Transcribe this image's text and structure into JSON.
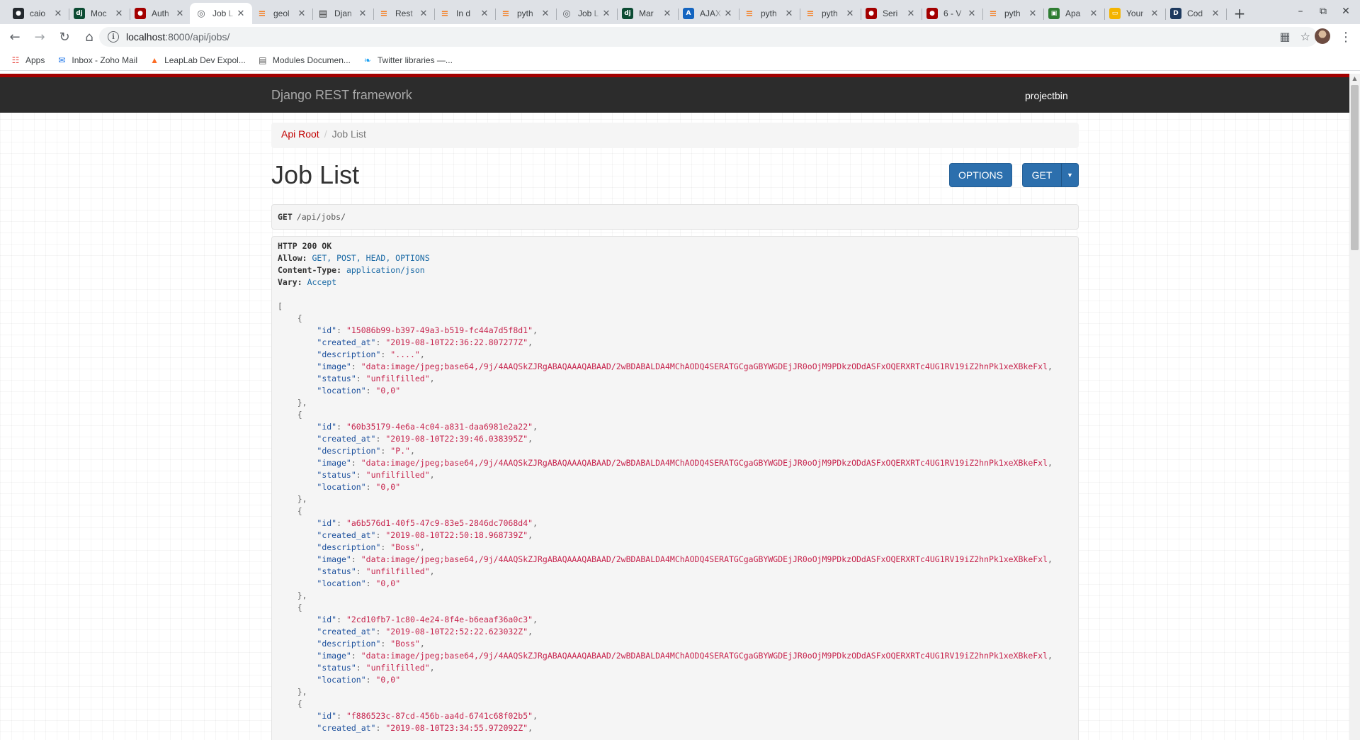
{
  "browser": {
    "tabs": [
      {
        "title": "caio",
        "icon": "github-icon",
        "color": "#24292e"
      },
      {
        "title": "Moc",
        "icon": "django-icon",
        "color": "#0c4b33"
      },
      {
        "title": "Auth",
        "icon": "django-rest-icon",
        "color": "#a30000"
      },
      {
        "title": "Job L",
        "icon": "globe-icon",
        "color": "#5f6368",
        "active": true
      },
      {
        "title": "geol",
        "icon": "stackoverflow-icon",
        "color": "#f48024"
      },
      {
        "title": "Djan",
        "icon": "book-icon",
        "color": "#333333"
      },
      {
        "title": "Rest",
        "icon": "stackoverflow-icon",
        "color": "#f48024"
      },
      {
        "title": "In d",
        "icon": "stackoverflow-icon",
        "color": "#f48024"
      },
      {
        "title": "pyth",
        "icon": "stackoverflow-icon",
        "color": "#f48024"
      },
      {
        "title": "Job L",
        "icon": "globe-icon",
        "color": "#5f6368"
      },
      {
        "title": "Mar",
        "icon": "django-icon",
        "color": "#0c4b33"
      },
      {
        "title": "AJAX",
        "icon": "ajax-icon",
        "color": "#1565c0"
      },
      {
        "title": "pyth",
        "icon": "stackoverflow-icon",
        "color": "#f48024"
      },
      {
        "title": "pyth",
        "icon": "stackoverflow-icon",
        "color": "#f48024"
      },
      {
        "title": "Seri",
        "icon": "django-rest-icon",
        "color": "#a30000"
      },
      {
        "title": "6 - V",
        "icon": "django-rest-icon",
        "color": "#a30000"
      },
      {
        "title": "pyth",
        "icon": "stackoverflow-icon",
        "color": "#f48024"
      },
      {
        "title": "Apa",
        "icon": "apache-icon",
        "color": "#2e7d32"
      },
      {
        "title": "Your",
        "icon": "slides-icon",
        "color": "#f4b400"
      },
      {
        "title": "Cod",
        "icon": "codepen-icon",
        "color": "#1e3a5f"
      }
    ],
    "url_host": "localhost",
    "url_rest": ":8000/api/jobs/",
    "bookmarks": [
      {
        "label": "Apps",
        "icon": "apps-grid-icon"
      },
      {
        "label": "Inbox - Zoho Mail",
        "icon": "mail-icon"
      },
      {
        "label": "LeapLab Dev Expol...",
        "icon": "gitlab-icon"
      },
      {
        "label": "Modules Documen...",
        "icon": "document-icon"
      },
      {
        "label": "Twitter libraries —...",
        "icon": "twitter-icon"
      }
    ]
  },
  "navbar": {
    "brand": "Django REST framework",
    "user": "projectbin"
  },
  "breadcrumb": {
    "root": "Api Root",
    "separator": "/",
    "current": "Job List"
  },
  "page": {
    "title": "Job List",
    "options_label": "OPTIONS",
    "get_label": "GET"
  },
  "request": {
    "method": "GET",
    "path": "/api/jobs/"
  },
  "response": {
    "status": "HTTP 200 OK",
    "headers": [
      {
        "name": "Allow:",
        "value": "GET, POST, HEAD, OPTIONS"
      },
      {
        "name": "Content-Type:",
        "value": "application/json"
      },
      {
        "name": "Vary:",
        "value": "Accept"
      }
    ],
    "image_prefix": "\"data:image/jpeg;base64,/9j/4AAQSkZJRgABAQAAAQABAAD/2wBDABALDA4MChAODQ4SERATGCgaGBYWGDEjJR0oOjM9PDkzODdASFxOQERXRTc4UG1RV19iZ2hnPk1xeXBkeFxl",
    "jobs": [
      {
        "id": "\"15086b99-b397-49a3-b519-fc44a7d5f8d1\"",
        "created_at": "\"2019-08-10T22:36:22.807277Z\"",
        "description": "\"....\"",
        "status": "\"unfilfilled\"",
        "location": "\"0,0\""
      },
      {
        "id": "\"60b35179-4e6a-4c04-a831-daa6981e2a22\"",
        "created_at": "\"2019-08-10T22:39:46.038395Z\"",
        "description": "\"P.\"",
        "status": "\"unfilfilled\"",
        "location": "\"0,0\""
      },
      {
        "id": "\"a6b576d1-40f5-47c9-83e5-2846dc7068d4\"",
        "created_at": "\"2019-08-10T22:50:18.968739Z\"",
        "description": "\"Boss\"",
        "status": "\"unfilfilled\"",
        "location": "\"0,0\""
      },
      {
        "id": "\"2cd10fb7-1c80-4e24-8f4e-b6eaaf36a0c3\"",
        "created_at": "\"2019-08-10T22:52:22.623032Z\"",
        "description": "\"Boss\"",
        "status": "\"unfilfilled\"",
        "location": "\"0,0\""
      },
      {
        "id": "\"f886523c-87cd-456b-aa4d-6741c68f02b5\"",
        "created_at": "\"2019-08-10T23:34:55.972092Z\""
      }
    ]
  },
  "colors": {
    "drf_red": "#a30000",
    "navbar_bg": "#2c2c2c",
    "button_blue": "#2c6fad",
    "link_red": "#c20000",
    "json_string": "#c7254e"
  }
}
